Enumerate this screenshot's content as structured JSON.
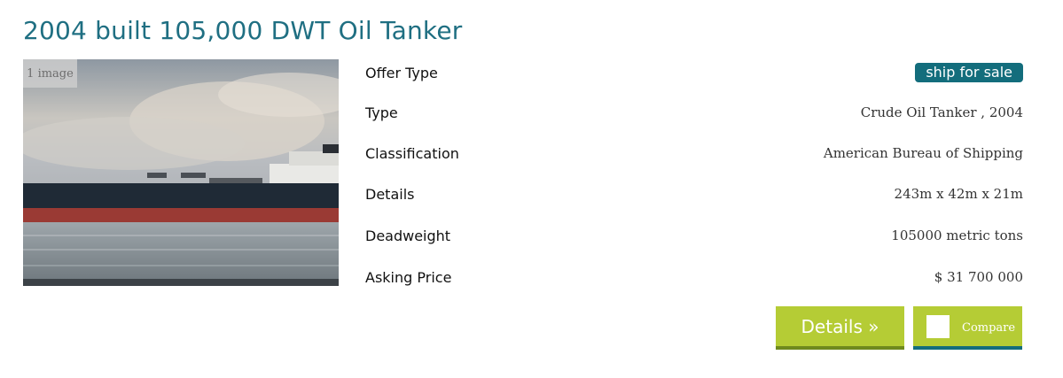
{
  "listing": {
    "title": "2004 built 105,000 DWT Oil Tanker",
    "image_count_label": "1 image",
    "offer_type": {
      "label": "Offer Type",
      "value": "ship for sale"
    },
    "type": {
      "label": "Type",
      "value": "Crude Oil Tanker , 2004"
    },
    "classification": {
      "label": "Classification",
      "value": "American Bureau of Shipping"
    },
    "details": {
      "label": "Details",
      "value": "243m x 42m x 21m"
    },
    "deadweight": {
      "label": "Deadweight",
      "value": "105000 metric tons"
    },
    "asking_price": {
      "label": "Asking Price",
      "value": "$ 31 700 000"
    }
  },
  "actions": {
    "details_label": "Details »",
    "compare_label": "Compare"
  },
  "colors": {
    "title": "#1f6f82",
    "tag_bg": "#136d7c",
    "button_green": "#b5cc35"
  }
}
